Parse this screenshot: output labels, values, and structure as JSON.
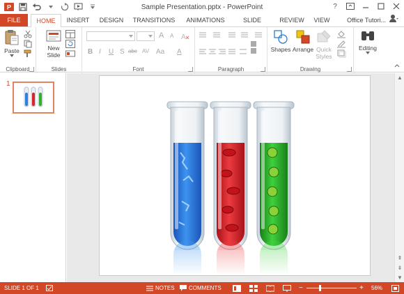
{
  "window": {
    "title": "Sample Presentation.pptx - PowerPoint",
    "help": "?"
  },
  "tabs": {
    "file": "FILE",
    "items": [
      "HOME",
      "INSERT",
      "DESIGN",
      "TRANSITIONS",
      "ANIMATIONS",
      "SLIDE SHOW",
      "REVIEW",
      "VIEW"
    ],
    "active": "HOME",
    "account": "Office Tutori..."
  },
  "ribbon": {
    "clipboard": {
      "paste": "Paste",
      "label": "Clipboard"
    },
    "slides": {
      "new_slide_line1": "New",
      "new_slide_line2": "Slide",
      "label": "Slides"
    },
    "font": {
      "label": "Font",
      "buttons": [
        "B",
        "I",
        "U",
        "S",
        "abc",
        "AV",
        "Aa",
        "A"
      ],
      "grow": "A",
      "shrink": "A"
    },
    "paragraph": {
      "label": "Paragraph"
    },
    "drawing": {
      "shapes": "Shapes",
      "arrange": "Arrange",
      "quick_styles_line1": "Quick",
      "quick_styles_line2": "Styles",
      "label": "Drawing"
    },
    "editing": {
      "label": "Editing"
    }
  },
  "thumbnails": {
    "slide_number": "1"
  },
  "status": {
    "slide_info": "SLIDE 1 OF 1",
    "notes": "NOTES",
    "comments": "COMMENTS",
    "zoom_minus": "−",
    "zoom_plus": "+",
    "zoom": "56%"
  },
  "colors": {
    "accent": "#d24726",
    "tube_blue": "#2f7fe0",
    "tube_red": "#d8242a",
    "tube_green": "#2fb12e"
  }
}
